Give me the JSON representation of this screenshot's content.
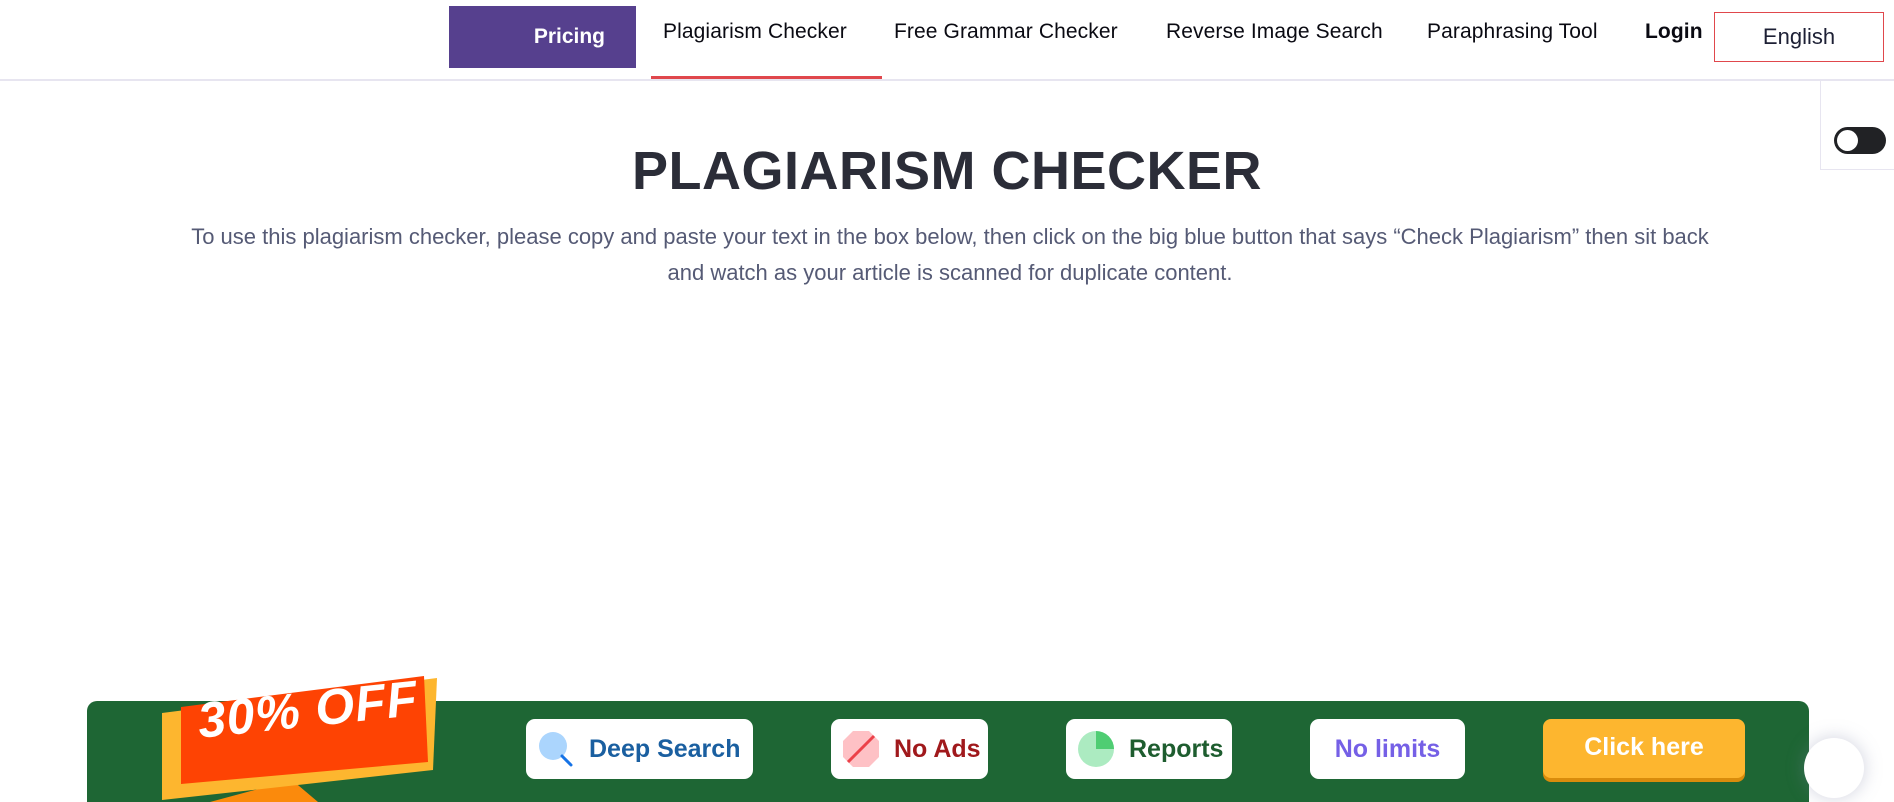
{
  "header": {
    "pricing_label": "Pricing",
    "nav": [
      {
        "label": "Plagiarism Checker",
        "active": true
      },
      {
        "label": "Free Grammar Checker",
        "active": false
      },
      {
        "label": "Reverse Image Search",
        "active": false
      },
      {
        "label": "Paraphrasing Tool",
        "active": false
      }
    ],
    "login_label": "Login",
    "language": "English",
    "active_accent": "#e0474c",
    "pricing_color": "#56408e"
  },
  "theme_toggle": {
    "icon": "toggle-switch",
    "state": "off"
  },
  "hero": {
    "title": "PLAGIARISM CHECKER",
    "description": "To use this plagiarism checker, please copy and paste your text in the box below, then click on the big blue button that says “Check Plagiarism” then sit back and watch as your article is scanned for duplicate content."
  },
  "promo": {
    "badge": "30% OFF",
    "background": "#1e6634",
    "features": [
      {
        "label": "Deep Search",
        "icon": "magnifier-icon"
      },
      {
        "label": "No Ads",
        "icon": "no-ads-icon"
      },
      {
        "label": "Reports",
        "icon": "pie-chart-icon"
      },
      {
        "label": "No limits",
        "icon": ""
      }
    ],
    "cta_label": "Click here",
    "cta_color": "#fdb62f"
  },
  "chat": {
    "icon": "chat-bubble"
  }
}
